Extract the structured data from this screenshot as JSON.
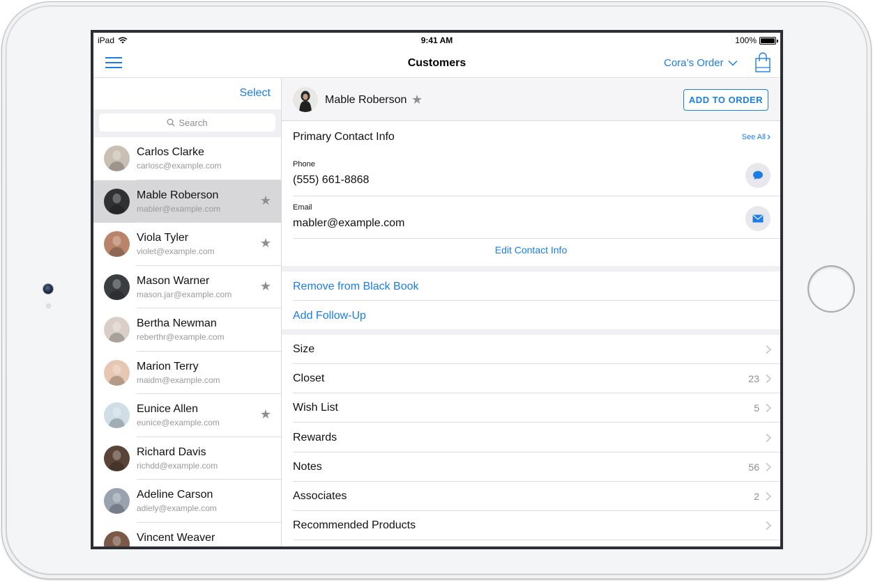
{
  "status_bar": {
    "device": "iPad",
    "time": "9:41 AM",
    "battery": "100%"
  },
  "nav": {
    "title": "Customers",
    "order_label": "Cora’s Order"
  },
  "sidebar": {
    "select_label": "Select",
    "search_placeholder": "Search",
    "contacts": [
      {
        "name": "Carlos Clarke",
        "email": "carlosc@example.com",
        "starred": false,
        "selected": false,
        "avatar": "#c9bfb3"
      },
      {
        "name": "Mable Roberson",
        "email": "mabler@example.com",
        "starred": true,
        "selected": true,
        "avatar": "#2f3133"
      },
      {
        "name": "Viola Tyler",
        "email": "violet@example.com",
        "starred": true,
        "selected": false,
        "avatar": "#b9846a"
      },
      {
        "name": "Mason Warner",
        "email": "mason.jar@example.com",
        "starred": true,
        "selected": false,
        "avatar": "#3a3d42"
      },
      {
        "name": "Bertha Newman",
        "email": "reberthr@example.com",
        "starred": false,
        "selected": false,
        "avatar": "#d9cfc8"
      },
      {
        "name": "Marion Terry",
        "email": "maidm@example.com",
        "starred": false,
        "selected": false,
        "avatar": "#e6c7b1"
      },
      {
        "name": "Eunice Allen",
        "email": "eunice@example.com",
        "starred": true,
        "selected": false,
        "avatar": "#cfdde6"
      },
      {
        "name": "Richard Davis",
        "email": "richdd@example.com",
        "starred": false,
        "selected": false,
        "avatar": "#5a4438"
      },
      {
        "name": "Adeline Carson",
        "email": "adiely@example.com",
        "starred": false,
        "selected": false,
        "avatar": "#9aa2b0"
      },
      {
        "name": "Vincent Weaver",
        "email": "",
        "starred": false,
        "selected": false,
        "avatar": "#7a5a46"
      }
    ]
  },
  "detail": {
    "name": "Mable Roberson",
    "add_button": "ADD TO ORDER",
    "contact_section_title": "Primary Contact Info",
    "see_all": "See All",
    "phone_label": "Phone",
    "phone_value": "(555) 661-8868",
    "email_label": "Email",
    "email_value": "mabler@example.com",
    "edit_link": "Edit Contact Info",
    "remove_link": "Remove from Black Book",
    "followup_link": "Add Follow-Up",
    "rows": [
      {
        "label": "Size",
        "count": ""
      },
      {
        "label": "Closet",
        "count": "23"
      },
      {
        "label": "Wish List",
        "count": "5"
      },
      {
        "label": "Rewards",
        "count": ""
      },
      {
        "label": "Notes",
        "count": "56"
      },
      {
        "label": "Associates",
        "count": "2"
      },
      {
        "label": "Recommended Products",
        "count": ""
      }
    ]
  },
  "colors": {
    "accent": "#1a7ee6",
    "selected_row": "#d7d7d9",
    "star": "#8e8e93"
  }
}
